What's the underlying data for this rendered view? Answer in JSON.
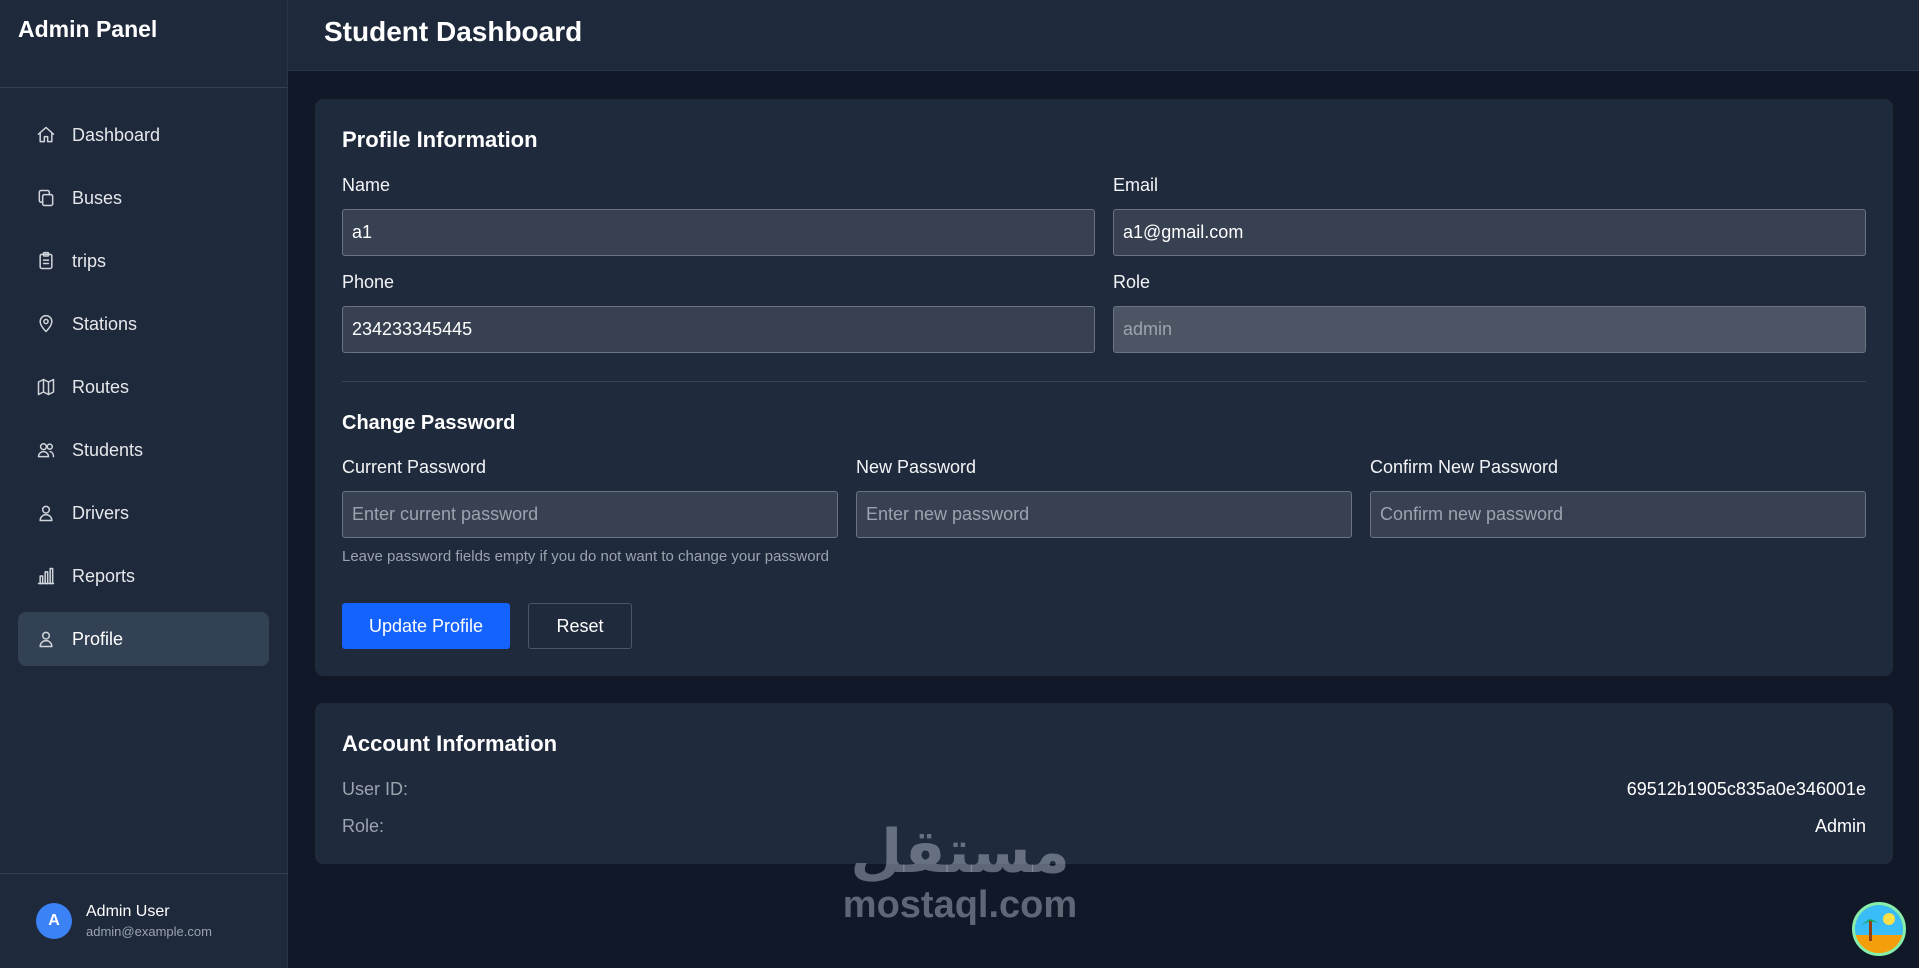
{
  "sidebar": {
    "title": "Admin Panel",
    "items": [
      {
        "label": "Dashboard",
        "icon": "home-icon"
      },
      {
        "label": "Buses",
        "icon": "copy-icon"
      },
      {
        "label": "trips",
        "icon": "clipboard-icon"
      },
      {
        "label": "Stations",
        "icon": "map-pin-icon"
      },
      {
        "label": "Routes",
        "icon": "map-icon"
      },
      {
        "label": "Students",
        "icon": "users-icon"
      },
      {
        "label": "Drivers",
        "icon": "user-icon"
      },
      {
        "label": "Reports",
        "icon": "bar-chart-icon"
      },
      {
        "label": "Profile",
        "icon": "user-icon",
        "active": true
      }
    ],
    "user": {
      "initial": "A",
      "name": "Admin User",
      "email": "admin@example.com"
    }
  },
  "header": {
    "title": "Student Dashboard"
  },
  "profile": {
    "title": "Profile Information",
    "name_label": "Name",
    "name_value": "a1",
    "email_label": "Email",
    "email_value": "a1@gmail.com",
    "phone_label": "Phone",
    "phone_value": "234233345445",
    "role_label": "Role",
    "role_value": "admin"
  },
  "password": {
    "title": "Change Password",
    "current_label": "Current Password",
    "current_placeholder": "Enter current password",
    "new_label": "New Password",
    "new_placeholder": "Enter new password",
    "confirm_label": "Confirm New Password",
    "confirm_placeholder": "Confirm new password",
    "hint": "Leave password fields empty if you do not want to change your password"
  },
  "actions": {
    "update_label": "Update Profile",
    "reset_label": "Reset"
  },
  "account": {
    "title": "Account Information",
    "user_id_label": "User ID:",
    "user_id_value": "69512b1905c835a0e346001e",
    "role_label": "Role:",
    "role_value": "Admin"
  },
  "watermark": {
    "arabic": "مستقل",
    "latin": "mostaql.com"
  },
  "colors": {
    "accent": "#1463ff",
    "sidebar_bg": "#1e293b",
    "page_bg": "#111827",
    "card_bg": "#1f2a3c"
  }
}
